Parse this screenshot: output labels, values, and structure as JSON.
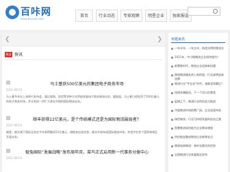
{
  "header": {
    "logo_text": "百咔网",
    "logo_sub": "www.baicaw.com",
    "nav": [
      "首页",
      "行业动态",
      "专家观察",
      "明星企业",
      "独家报道"
    ],
    "search_placeholder": ""
  },
  "main": {
    "section_badge": "热点",
    "section_title": "快讯",
    "articles": [
      {
        "title": "马士基获500亿美元的集团电子商务市场",
        "meta": "2021-08-03",
        "body": "马士基今年在上海举行发布会，通过收购、投资等多种方式积极发展电子商务物流业务，据报道，马士基已经投资了500亿美元的电子商务市场，并计划进一步扩大其在中国的国际物流业务。"
      },
      {
        "title": "顺丰获得22亿美元，是个传统模式还是为国际物流破局者？",
        "meta": "2021-08-03",
        "body": "据悉，顺丰旗下国际业务在今年获得融资22亿美元，借助其自身优势，顺丰开始布局国际物流市场，并逐步在多个国家和地区开展业务。"
      },
      {
        "title": "极兔国际“发展战略”发布周年庆，菜鸟正式启用新一代事务分拨中心",
        "meta": "2021-08-03",
        "body": ""
      }
    ]
  },
  "sidebar": {
    "title": "专题资讯",
    "items": [
      "一年半年，一年五年，前途光明的物流业",
      "2021年，中小微物流企业如何借力？",
      "新零售时代，物流企业迎来新机遇",
      "跨境物流服务进入新阶段，行业或将迎来洗牌",
      "物流行业“专业化”时代，谁能笑到最后？",
      "快递末端配送，下一个风口在哪里",
      "疫情之下，物流行业的机会与挑战",
      "冷链物流市场前景广阔，企业加速布局",
      "绿色物流，行业可持续发展的必由之路",
      "智慧物流如何助力企业降本增效",
      "供应链金融成物流企业新增长点",
      "跨境电商物流：海外仓模式的优势",
      "全国物流行业发展报告发布"
    ]
  }
}
